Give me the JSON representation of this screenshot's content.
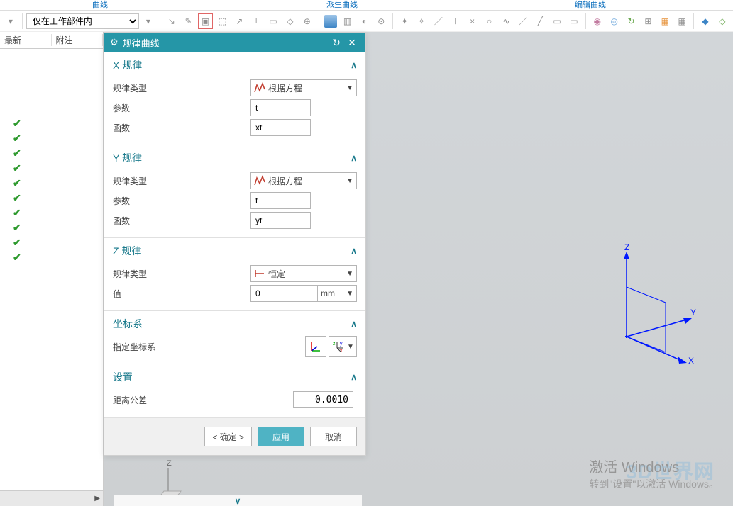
{
  "tabs": {
    "t1": "曲线",
    "t2": "派生曲线",
    "t3": "编辑曲线"
  },
  "toolbar": {
    "scope_select": "仅在工作部件内"
  },
  "left_panel": {
    "col1": "最新",
    "col2": "附注",
    "check_rows": 10
  },
  "dialog": {
    "title": "规律曲线",
    "x_rule": {
      "header": "X 规律",
      "type_label": "规律类型",
      "type_value": "根据方程",
      "param_label": "参数",
      "param_value": "t",
      "func_label": "函数",
      "func_value": "xt"
    },
    "y_rule": {
      "header": "Y 规律",
      "type_label": "规律类型",
      "type_value": "根据方程",
      "param_label": "参数",
      "param_value": "t",
      "func_label": "函数",
      "func_value": "yt"
    },
    "z_rule": {
      "header": "Z 规律",
      "type_label": "规律类型",
      "type_value": "恒定",
      "value_label": "值",
      "value_num": "0",
      "value_unit": "mm"
    },
    "csys": {
      "header": "坐标系",
      "specify_label": "指定坐标系"
    },
    "settings": {
      "header": "设置",
      "tol_label": "距离公差",
      "tol_value": "0.0010"
    },
    "buttons": {
      "ok": "< 确定 >",
      "apply": "应用",
      "cancel": "取消"
    }
  },
  "viewport": {
    "axes": {
      "x": "X",
      "y": "Y",
      "z": "Z"
    },
    "watermark_line1": "激活 Windows",
    "watermark_line2": "转到\"设置\"以激活 Windows。",
    "brand": "3D世界网"
  }
}
